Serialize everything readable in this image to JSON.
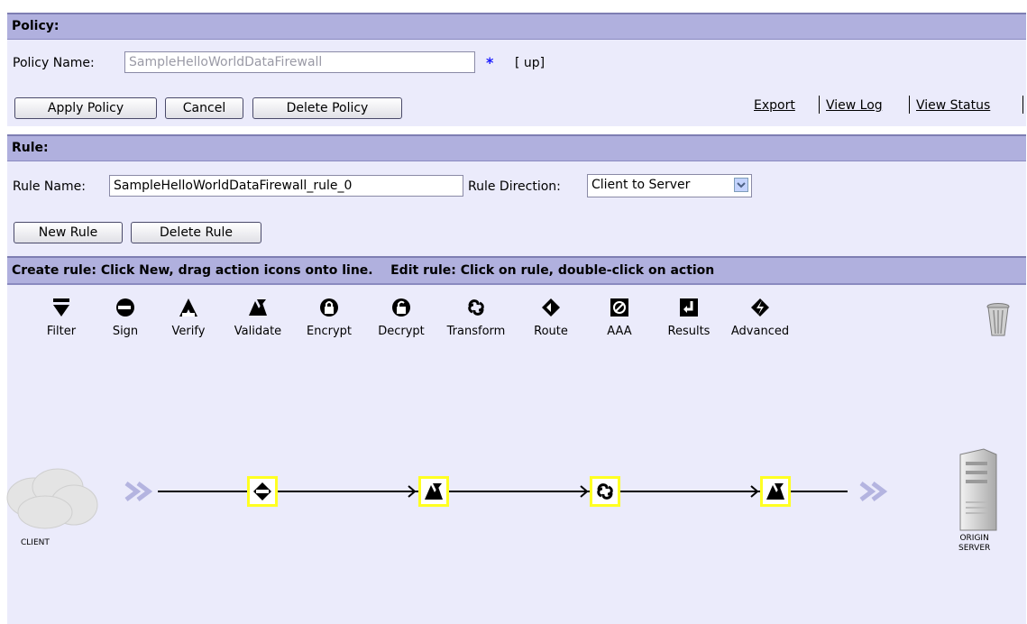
{
  "policy": {
    "header": "Policy:",
    "name_label": "Policy Name:",
    "name_value": "SampleHelloWorldDataFirewall",
    "required_mark": "*",
    "status": "[ up]",
    "buttons": {
      "apply": "Apply Policy",
      "cancel": "Cancel",
      "delete": "Delete Policy"
    },
    "links": {
      "export": "Export",
      "view_log": "View Log",
      "view_status": "View Status"
    }
  },
  "rule": {
    "header": "Rule:",
    "name_label": "Rule Name:",
    "name_value": "SampleHelloWorldDataFirewall_rule_0",
    "direction_label": "Rule Direction:",
    "direction_value": "Client to Server",
    "buttons": {
      "new": "New Rule",
      "delete": "Delete Rule"
    },
    "instructions": "Create rule: Click New, drag action icons onto line.    Edit rule: Click on rule, double-click on action"
  },
  "palette": [
    {
      "label": "Filter",
      "icon": "filter-icon"
    },
    {
      "label": "Sign",
      "icon": "sign-icon"
    },
    {
      "label": "Verify",
      "icon": "verify-icon"
    },
    {
      "label": "Validate",
      "icon": "validate-icon"
    },
    {
      "label": "Encrypt",
      "icon": "encrypt-icon"
    },
    {
      "label": "Decrypt",
      "icon": "decrypt-icon"
    },
    {
      "label": "Transform",
      "icon": "transform-icon"
    },
    {
      "label": "Route",
      "icon": "route-icon"
    },
    {
      "label": "AAA",
      "icon": "aaa-icon"
    },
    {
      "label": "Results",
      "icon": "results-icon"
    },
    {
      "label": "Advanced",
      "icon": "advanced-icon"
    }
  ],
  "pipeline": {
    "client_line1": "CLIENT",
    "server_line1": "ORIGIN",
    "server_line2": "SERVER",
    "actions": [
      "match-icon",
      "validate-icon",
      "transform-icon",
      "validate-icon"
    ]
  },
  "colors": {
    "header_bar": "#b0b0de",
    "panel": "#ebebfb",
    "action_highlight": "#ffff22",
    "arrows": "#b4b4e0"
  }
}
